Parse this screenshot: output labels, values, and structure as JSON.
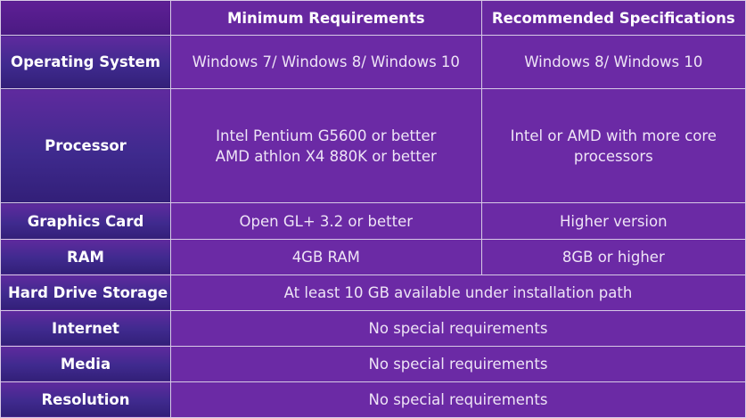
{
  "table": {
    "headers": {
      "minimum": "Minimum Requirements",
      "recommended": "Recommended Specifications"
    },
    "rows": {
      "os": {
        "label": "Operating System",
        "minimum": "Windows 7/ Windows 8/ Windows 10",
        "recommended": "Windows 8/ Windows 10"
      },
      "processor": {
        "label": "Processor",
        "minimum_lines": [
          "Intel Pentium G5600 or better",
          "AMD athlon X4 880K or better"
        ],
        "recommended_lines": [
          "Intel or AMD with more core",
          "processors"
        ]
      },
      "graphics": {
        "label": "Graphics Card",
        "minimum": "Open GL+ 3.2 or better",
        "recommended": "Higher version"
      },
      "ram": {
        "label": "RAM",
        "minimum": "4GB RAM",
        "recommended": "8GB or higher"
      },
      "storage": {
        "label": "Hard Drive Storage",
        "value": "At least 10 GB available under installation path"
      },
      "internet": {
        "label": "Internet",
        "value": "No special requirements"
      },
      "media": {
        "label": "Media",
        "value": "No special requirements"
      },
      "resolution": {
        "label": "Resolution",
        "value": "No special requirements"
      }
    }
  },
  "colors": {
    "value_cell": "#6b2aa5",
    "header_cell": "#6728a0",
    "label_cell_top": "#5f2a9e",
    "label_cell_bottom": "#321f78",
    "border": "#d7c9e6",
    "text": "#ffffff"
  }
}
